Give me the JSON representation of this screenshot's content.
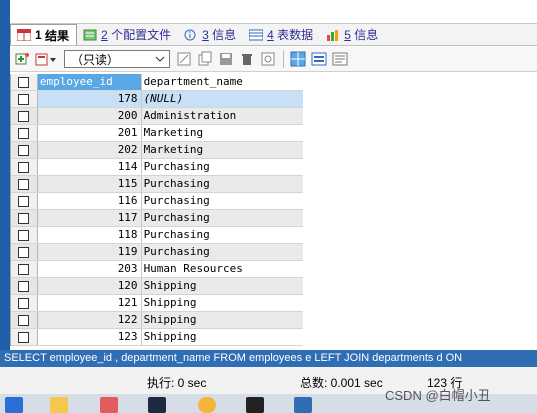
{
  "tabs": [
    {
      "num": "1",
      "label": "结果",
      "active": true
    },
    {
      "num": "2",
      "label": "个配置文件"
    },
    {
      "num": "3",
      "label": "信息"
    },
    {
      "num": "4",
      "label": "表数据"
    },
    {
      "num": "5",
      "label": "信息"
    }
  ],
  "toolbar": {
    "mode_select": "（只读）"
  },
  "grid": {
    "headers": {
      "id": "employee_id",
      "name": "department_name"
    },
    "rows": [
      {
        "id": "178",
        "name": "(NULL)"
      },
      {
        "id": "200",
        "name": "Administration"
      },
      {
        "id": "201",
        "name": "Marketing"
      },
      {
        "id": "202",
        "name": "Marketing"
      },
      {
        "id": "114",
        "name": "Purchasing"
      },
      {
        "id": "115",
        "name": "Purchasing"
      },
      {
        "id": "116",
        "name": "Purchasing"
      },
      {
        "id": "117",
        "name": "Purchasing"
      },
      {
        "id": "118",
        "name": "Purchasing"
      },
      {
        "id": "119",
        "name": "Purchasing"
      },
      {
        "id": "203",
        "name": "Human Resources"
      },
      {
        "id": "120",
        "name": "Shipping"
      },
      {
        "id": "121",
        "name": "Shipping"
      },
      {
        "id": "122",
        "name": "Shipping"
      },
      {
        "id": "123",
        "name": "Shipping"
      }
    ]
  },
  "sql": "SELECT employee_id , department_name FROM employees e LEFT JOIN departments d ON",
  "status": {
    "exec_time": "执行: 0 sec",
    "total_time": "总数: 0.001 sec",
    "row_count": "123 行"
  },
  "watermark": "CSDN @白帽小丑",
  "colors": {
    "accent": "#2f6eb5",
    "header": "#5aa7e6",
    "selected": "#c7dff7"
  }
}
